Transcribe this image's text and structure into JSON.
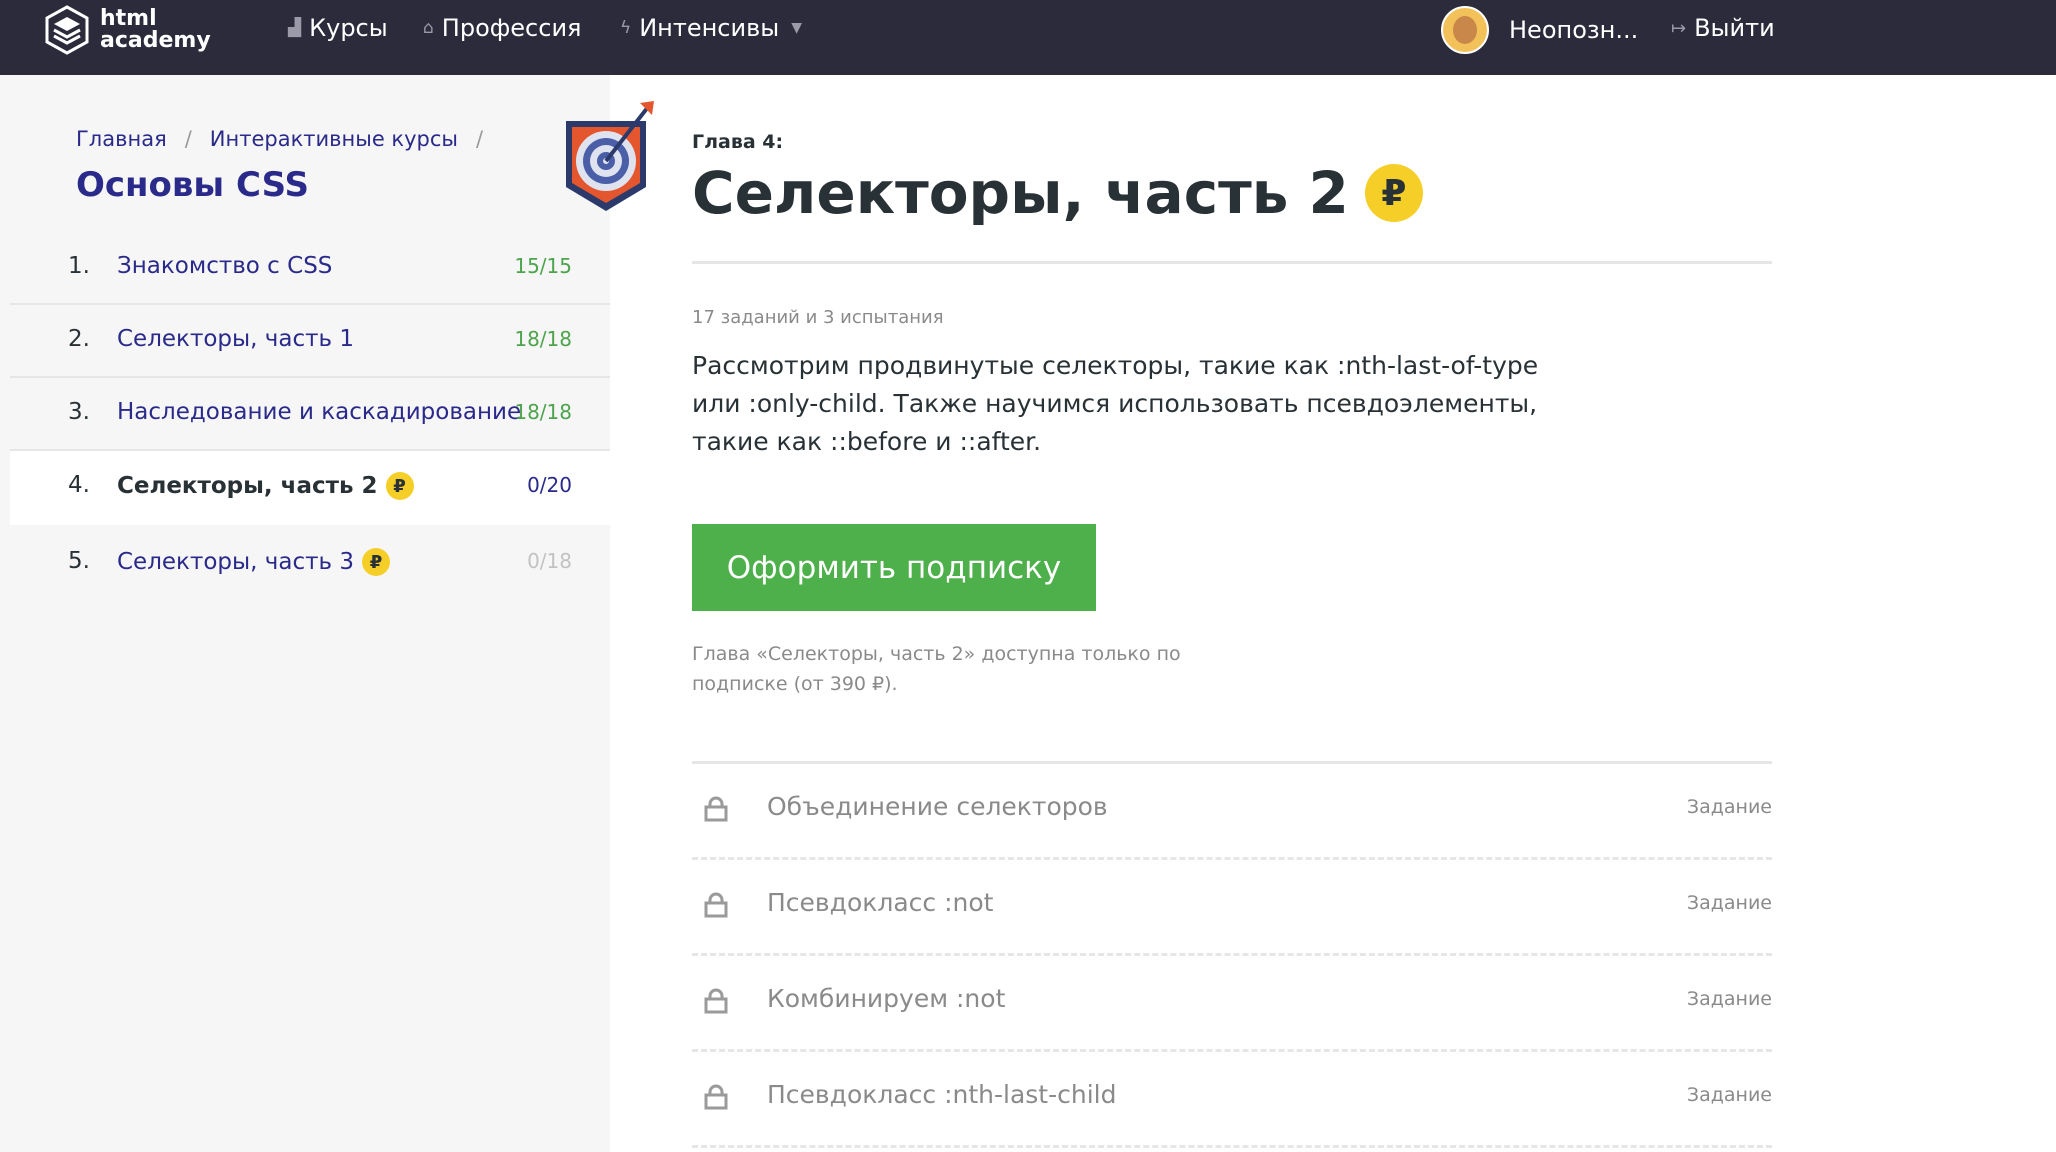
{
  "header": {
    "logo_line1": "html",
    "logo_line2": "academy",
    "nav": [
      {
        "label": "Курсы",
        "icon": "bars-icon"
      },
      {
        "label": "Профессия",
        "icon": "graduation-cap-icon"
      },
      {
        "label": "Интенсивы",
        "icon": "lightning-icon"
      }
    ],
    "user_name": "Неопозн...",
    "logout_label": "Выйти"
  },
  "sidebar": {
    "breadcrumbs": [
      "Главная",
      "Интерактивные курсы"
    ],
    "course_title": "Основы CSS",
    "chapters": [
      {
        "num": "1.",
        "name": "Знакомство с CSS",
        "progress": "15/15",
        "paid": false,
        "active": false
      },
      {
        "num": "2.",
        "name": "Селекторы, часть 1",
        "progress": "18/18",
        "paid": false,
        "active": false
      },
      {
        "num": "3.",
        "name": "Наследование и каскадирование",
        "progress": "18/18",
        "paid": false,
        "active": false
      },
      {
        "num": "4.",
        "name": "Селекторы, часть 2",
        "progress": "0/20",
        "paid": true,
        "active": true
      },
      {
        "num": "5.",
        "name": "Селекторы, часть 3",
        "progress": "0/18",
        "paid": true,
        "active": false
      }
    ]
  },
  "main": {
    "chapter_label": "Глава 4:",
    "chapter_title": "Селекторы, часть 2",
    "currency_symbol": "₽",
    "meta": "17 заданий и 3 испытания",
    "description": "Рассмотрим продвинутые селекторы, такие как :nth-last-of-type или :only-child. Также научимся использовать псевдоэлементы, такие как ::before и ::after.",
    "subscribe_label": "Оформить подписку",
    "note": "Глава «Селекторы, часть 2» доступна только по подписке (от 390 ₽).",
    "tasks": [
      {
        "name": "Объединение селекторов",
        "type": "Задание"
      },
      {
        "name": "Псевдокласс :not",
        "type": "Задание"
      },
      {
        "name": "Комбинируем :not",
        "type": "Задание"
      },
      {
        "name": "Псевдокласс :nth-last-child",
        "type": "Задание"
      }
    ]
  },
  "colors": {
    "header_bg": "#2b2b3c",
    "link": "#2a2a8a",
    "progress_done": "#4ca44c",
    "button_green": "#4db04b",
    "coin_yellow": "#f5cf28"
  }
}
